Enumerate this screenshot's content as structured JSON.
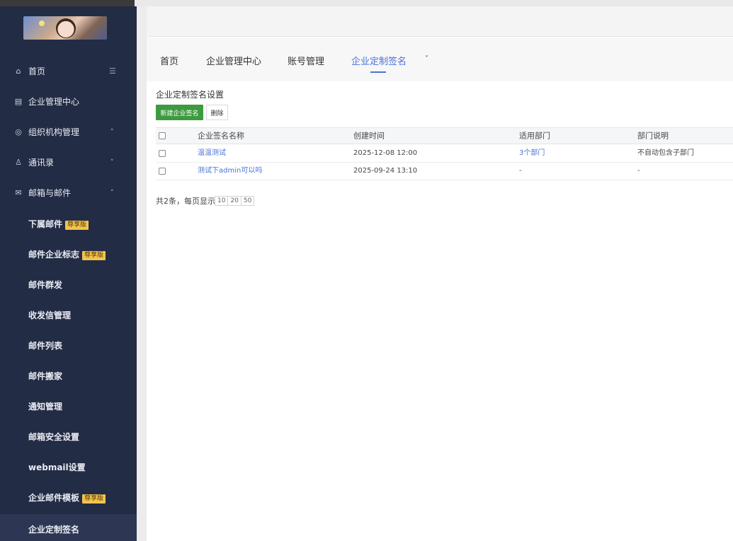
{
  "sidebar": {
    "items": [
      {
        "icon": "home-icon",
        "glyph": "⌂",
        "label": "首页",
        "extra": "collapse-icon"
      },
      {
        "icon": "document-icon",
        "glyph": "▤",
        "label": "企业管理中心"
      },
      {
        "icon": "org-icon",
        "glyph": "◎",
        "label": "组织机构管理",
        "chevron": "˅"
      },
      {
        "icon": "contacts-icon",
        "glyph": "♙",
        "label": "通讯录",
        "chevron": "˅"
      },
      {
        "icon": "mail-icon",
        "glyph": "✉",
        "label": "邮箱与邮件",
        "chevron": "˄"
      }
    ],
    "subitems": [
      {
        "label": "下属邮件",
        "badge": "尊享版"
      },
      {
        "label": "邮件企业标志",
        "badge": "尊享版"
      },
      {
        "label": "邮件群发"
      },
      {
        "label": "收发信管理"
      },
      {
        "label": "邮件列表"
      },
      {
        "label": "邮件搬家"
      },
      {
        "label": "通知管理"
      },
      {
        "label": "邮箱安全设置"
      },
      {
        "label": "webmail设置"
      },
      {
        "label": "企业邮件模板",
        "badge": "尊享版"
      },
      {
        "label": "企业定制签名"
      }
    ],
    "collapse_glyph": "☰"
  },
  "tabs": [
    {
      "label": "首页"
    },
    {
      "label": "企业管理中心"
    },
    {
      "label": "账号管理"
    },
    {
      "label": "企业定制签名"
    }
  ],
  "tab_more_glyph": "˅",
  "section_title": "企业定制签名设置",
  "buttons": {
    "new": "新建企业签名",
    "delete": "删除"
  },
  "table": {
    "headers": [
      "企业签名名称",
      "创建时间",
      "适用部门",
      "部门说明"
    ],
    "rows": [
      {
        "name": "温温测试",
        "created": "2025-12-08 12:00",
        "dept": "3个部门",
        "desc": "不自动包含子部门"
      },
      {
        "name": "测试下admin可以吗",
        "created": "2025-09-24 13:10",
        "dept": "-",
        "desc": "-"
      }
    ]
  },
  "pager": {
    "summary": "共2条，每页显示",
    "sizes": [
      "10",
      "20",
      "50"
    ]
  },
  "colors": {
    "sidebar_bg": "#232c45",
    "accent": "#4a72d6",
    "green": "#3e9a3e",
    "badge": "#f2c34f"
  }
}
